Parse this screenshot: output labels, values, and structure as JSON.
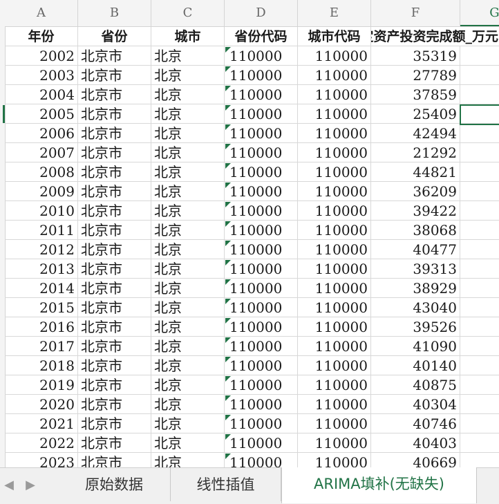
{
  "columns": [
    "A",
    "B",
    "C",
    "D",
    "E",
    "F",
    "G"
  ],
  "selected_column": "G",
  "header_row": [
    "年份",
    "省份",
    "城市",
    "省份代码",
    "城市代码",
    "固定资产投资完成额_万元"
  ],
  "rows": [
    [
      "2002",
      "北京市",
      "北京",
      "110000",
      "110000",
      "35319"
    ],
    [
      "2003",
      "北京市",
      "北京",
      "110000",
      "110000",
      "27789"
    ],
    [
      "2004",
      "北京市",
      "北京",
      "110000",
      "110000",
      "37859"
    ],
    [
      "2005",
      "北京市",
      "北京",
      "110000",
      "110000",
      "25409"
    ],
    [
      "2006",
      "北京市",
      "北京",
      "110000",
      "110000",
      "42494"
    ],
    [
      "2007",
      "北京市",
      "北京",
      "110000",
      "110000",
      "21292"
    ],
    [
      "2008",
      "北京市",
      "北京",
      "110000",
      "110000",
      "44821"
    ],
    [
      "2009",
      "北京市",
      "北京",
      "110000",
      "110000",
      "36209"
    ],
    [
      "2010",
      "北京市",
      "北京",
      "110000",
      "110000",
      "39422"
    ],
    [
      "2011",
      "北京市",
      "北京",
      "110000",
      "110000",
      "38068"
    ],
    [
      "2012",
      "北京市",
      "北京",
      "110000",
      "110000",
      "40477"
    ],
    [
      "2013",
      "北京市",
      "北京",
      "110000",
      "110000",
      "39313"
    ],
    [
      "2014",
      "北京市",
      "北京",
      "110000",
      "110000",
      "38929"
    ],
    [
      "2015",
      "北京市",
      "北京",
      "110000",
      "110000",
      "43040"
    ],
    [
      "2016",
      "北京市",
      "北京",
      "110000",
      "110000",
      "39526"
    ],
    [
      "2017",
      "北京市",
      "北京",
      "110000",
      "110000",
      "41090"
    ],
    [
      "2018",
      "北京市",
      "北京",
      "110000",
      "110000",
      "40140"
    ],
    [
      "2019",
      "北京市",
      "北京",
      "110000",
      "110000",
      "40875"
    ],
    [
      "2020",
      "北京市",
      "北京",
      "110000",
      "110000",
      "40304"
    ],
    [
      "2021",
      "北京市",
      "北京",
      "110000",
      "110000",
      "40746"
    ],
    [
      "2022",
      "北京市",
      "北京",
      "110000",
      "110000",
      "40403"
    ],
    [
      "2023",
      "北京市",
      "北京",
      "110000",
      "110000",
      "40669"
    ]
  ],
  "active_cell": "G5",
  "tabs": [
    {
      "label": "原始数据",
      "active": false
    },
    {
      "label": "线性插值",
      "active": false
    },
    {
      "label": "ARIMA填补(无缺失)",
      "active": true
    }
  ],
  "nav": {
    "prev_icon": "◀",
    "next_icon": "▶"
  },
  "colors": {
    "accent": "#217346",
    "grid": "#d8d8d8",
    "header_bg": "#f4f4f4"
  }
}
